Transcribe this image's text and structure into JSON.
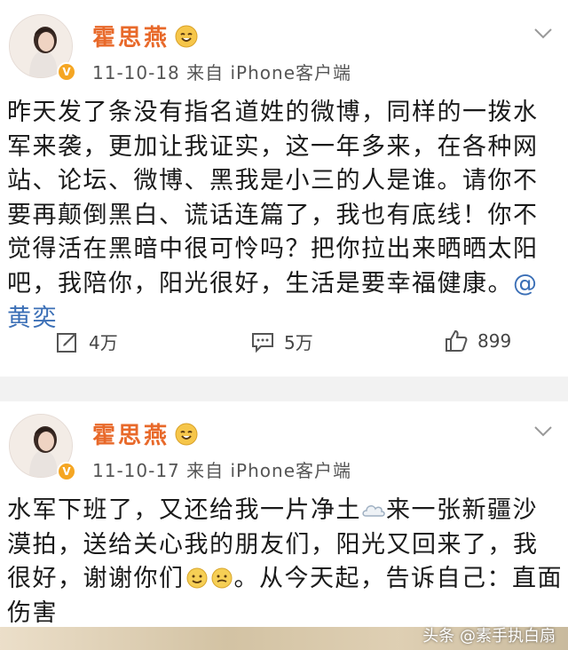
{
  "posts": [
    {
      "user_name": "霍思燕",
      "meta": "11-10-18  来自 iPhone客户端",
      "content": "昨天发了条没有指名道姓的微博，同样的一拨水军来袭，更加让我证实，这一年多来，在各种网站、论坛、微博、黑我是小三的人是谁。请你不要再颠倒黑白、谎话连篇了，我也有底线！你不觉得活在黑暗中很可怜吗？把你拉出来晒晒太阳吧，我陪你，阳光很好，生活是要幸福健康。",
      "mention": "@黄奕",
      "reposts": "4万",
      "comments": "5万",
      "likes": "899"
    },
    {
      "user_name": "霍思燕",
      "meta": "11-10-17  来自 iPhone客户端",
      "content_part1": "水军下班了，又还给我一片净土",
      "content_part2": "来一张新疆沙漠拍，送给关心我的朋友们，阳光又回来了，我很好，谢谢你们",
      "content_part3": "。从今天起，告诉自己：直面伤害"
    }
  ],
  "watermark": "头条 @素手执白扇",
  "icons": {
    "verified": "verified-v-badge",
    "name_emoji": "smile-emoji-icon",
    "menu": "chevron-down-icon",
    "repost": "repost-icon",
    "comment": "comment-icon",
    "like": "thumbs-up-icon",
    "cloud": "cloud-icon",
    "smiley": "smiley-emoji-icon"
  }
}
